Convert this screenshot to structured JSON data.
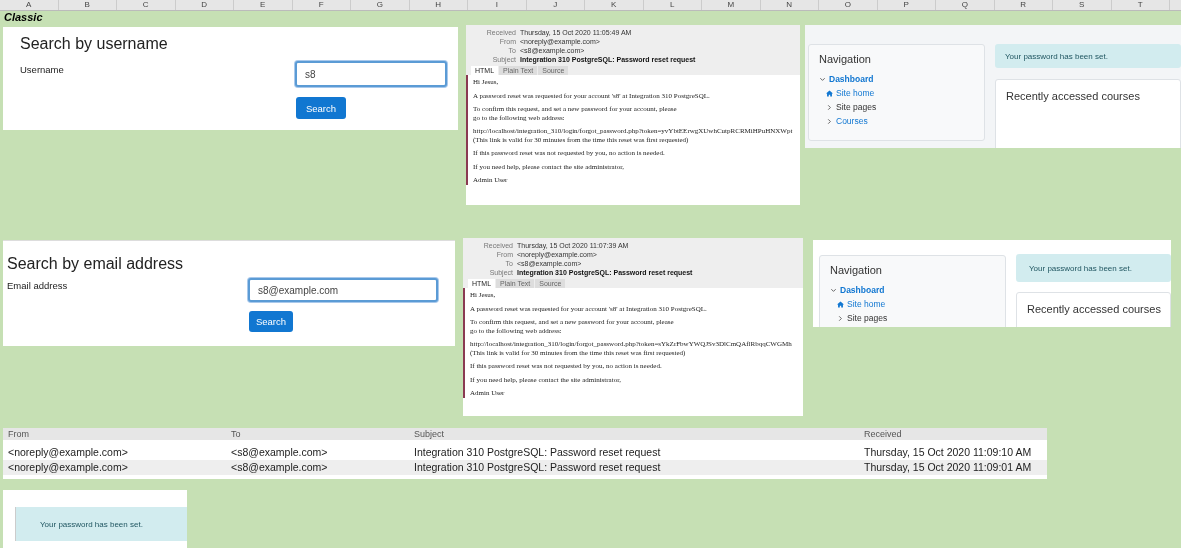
{
  "column_headers": [
    "A",
    "B",
    "C",
    "D",
    "E",
    "F",
    "G",
    "H",
    "I",
    "J",
    "K",
    "L",
    "M",
    "N",
    "O",
    "P",
    "Q",
    "R",
    "S",
    "T"
  ],
  "section_label": "Classic",
  "username_search": {
    "heading": "Search by username",
    "field_label": "Username",
    "value": "s8",
    "focused": true,
    "button": "Search"
  },
  "email_search": {
    "heading": "Search by email address",
    "field_label": "Email address",
    "value": "s8@example.com",
    "focused": true,
    "button": "Search"
  },
  "emails": [
    {
      "fields": [
        {
          "label": "Received",
          "value": "Thursday, 15 Oct 2020 11:05:49 AM",
          "bold": false
        },
        {
          "label": "From",
          "value": "<noreply@example.com>",
          "bold": false
        },
        {
          "label": "To",
          "value": "<s8@example.com>",
          "bold": false
        },
        {
          "label": "Subject",
          "value": "Integration 310 PostgreSQL: Password reset request",
          "bold": true
        }
      ],
      "tabs": [
        {
          "label": "HTML",
          "selected": true
        },
        {
          "label": "Plain Text",
          "selected": false
        },
        {
          "label": "Source",
          "selected": false
        }
      ],
      "paragraphs": [
        [
          "Hi Jesus,"
        ],
        [
          "A password reset was requested for your account 's8' at Integration 310 PostgreSQL."
        ],
        [
          "To confirm this request, and set a new password for your account, please",
          "go to the following web address:"
        ],
        [
          "http://localhost/integration_310/login/forgot_password.php?token=yvYbtEErwgXUwhCutpRCRMiHPuHNXWpt",
          "(This link is valid for 30 minutes from the time this reset was first requested)"
        ],
        [
          "If this password reset was not requested by you, no action is needed."
        ],
        [
          "If you need help, please contact the site administrator,"
        ],
        [
          "Admin User"
        ]
      ]
    },
    {
      "fields": [
        {
          "label": "Received",
          "value": "Thursday, 15 Oct 2020 11:07:39 AM",
          "bold": false
        },
        {
          "label": "From",
          "value": "<noreply@example.com>",
          "bold": false
        },
        {
          "label": "To",
          "value": "<s8@example.com>",
          "bold": false
        },
        {
          "label": "Subject",
          "value": "Integration 310 PostgreSQL: Password reset request",
          "bold": true
        }
      ],
      "tabs": [
        {
          "label": "HTML",
          "selected": true
        },
        {
          "label": "Plain Text",
          "selected": false
        },
        {
          "label": "Source",
          "selected": false
        }
      ],
      "paragraphs": [
        [
          "Hi Jesus,"
        ],
        [
          "A password reset was requested for your account 's8' at Integration 310 PostgreSQL."
        ],
        [
          "To confirm this request, and set a new password for your account, please",
          "go to the following web address:"
        ],
        [
          "http://localhost/integration_310/login/forgot_password.php?token=sYkZrFbwYWQJSv3DlCmQAflRbqqCWGMh",
          "(This link is valid for 30 minutes from the time this reset was first requested)"
        ],
        [
          "If this password reset was not requested by you, no action is needed."
        ],
        [
          "If you need help, please contact the site administrator,"
        ],
        [
          "Admin User"
        ]
      ]
    }
  ],
  "moodle_pages": [
    {
      "nav_title": "Navigation",
      "nav_items": [
        {
          "label": "Dashboard",
          "kind": "branch",
          "expanded": true,
          "link": true
        },
        {
          "label": "Site home",
          "kind": "home",
          "link": true
        },
        {
          "label": "Site pages",
          "kind": "branch",
          "expanded": false,
          "link": false
        },
        {
          "label": "Courses",
          "kind": "branch",
          "expanded": false,
          "link": true
        }
      ],
      "notice": "Your password has been set.",
      "courses_title": "Recently accessed courses"
    },
    {
      "nav_title": "Navigation",
      "nav_items": [
        {
          "label": "Dashboard",
          "kind": "branch",
          "expanded": true,
          "link": true
        },
        {
          "label": "Site home",
          "kind": "home",
          "link": true
        },
        {
          "label": "Site pages",
          "kind": "branch",
          "expanded": false,
          "link": false
        }
      ],
      "notice": "Your password has been set.",
      "courses_title": "Recently accessed courses"
    }
  ],
  "mail_list": {
    "columns": [
      "From",
      "To",
      "Subject",
      "Received"
    ],
    "rows": [
      [
        "<noreply@example.com>",
        "<s8@example.com>",
        "Integration 310 PostgreSQL: Password reset request",
        "Thursday, 15 Oct 2020 11:09:10 AM"
      ],
      [
        "<noreply@example.com>",
        "<s8@example.com>",
        "Integration 310 PostgreSQL: Password reset request",
        "Thursday, 15 Oct 2020 11:09:01 AM"
      ]
    ]
  },
  "password_notice": "Your password has been set."
}
